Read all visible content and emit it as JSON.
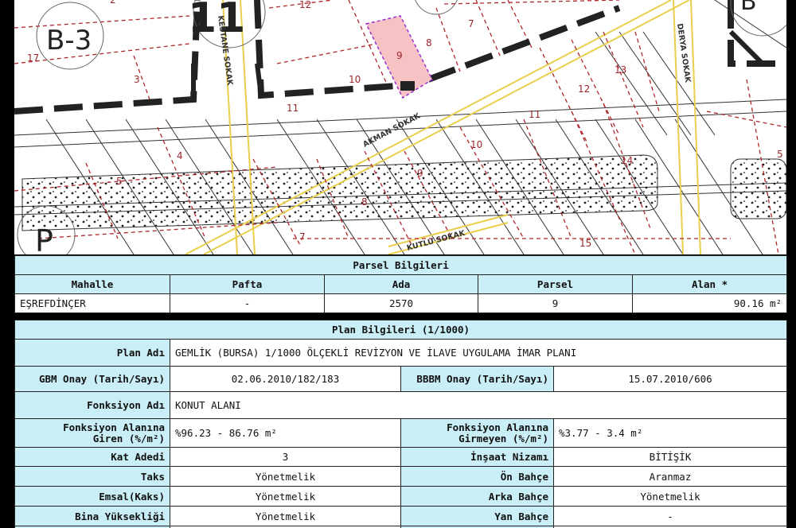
{
  "map": {
    "block_labels": [
      "B-3",
      "11",
      "P",
      "B"
    ],
    "streets": [
      "KESTANE SOKAK",
      "DERYA SOKAK",
      "AKMAN SOKAK",
      "KUTLU SOKAK"
    ],
    "parcel_numbers": [
      "2",
      "12",
      "17",
      "3",
      "7",
      "8",
      "9",
      "10",
      "11",
      "13",
      "12",
      "11",
      "10",
      "9",
      "8",
      "4",
      "5",
      "7",
      "14",
      "15",
      "5"
    ],
    "highlight_color": "#f6c2c4",
    "highlight_border": "#9b2fcf"
  },
  "parsel": {
    "title": "Parsel Bilgileri",
    "headers": [
      "Mahalle",
      "Pafta",
      "Ada",
      "Parsel",
      "Alan *"
    ],
    "values": [
      "EŞREFDİNÇER",
      "-",
      "2570",
      "9",
      "90.16 m²"
    ]
  },
  "plan": {
    "title": "Plan Bilgileri (1/1000)",
    "plan_adi_label": "Plan Adı",
    "plan_adi_value": "GEMLİK (BURSA) 1/1000 ÖLÇEKLİ REVİZYON VE İLAVE UYGULAMA İMAR PLANI",
    "gbm_label": "GBM Onay (Tarih/Sayı)",
    "gbm_value": "02.06.2010/182/183",
    "bbbm_label": "BBBM Onay (Tarih/Sayı)",
    "bbbm_value": "15.07.2010/606",
    "fonksiyon_label": "Fonksiyon Adı",
    "fonksiyon_value": "KONUT ALANI",
    "giren_label_1": "Fonksiyon Alanına",
    "giren_label_2": "Giren (%/m²)",
    "giren_value": "%96.23 - 86.76 m²",
    "girmeyen_label_1": "Fonksiyon Alanına",
    "girmeyen_label_2": "Girmeyen (%/m²)",
    "girmeyen_value": "%3.77 - 3.4 m²",
    "kat_label": "Kat Adedi",
    "kat_value": "3",
    "insaat_label": "İnşaat Nizamı",
    "insaat_value": "BİTİŞİK",
    "taks_label": "Taks",
    "taks_value": "Yönetmelik",
    "on_label": "Ön Bahçe",
    "on_value": "Aranmaz",
    "emsal_label": "Emsal(Kaks)",
    "emsal_value": "Yönetmelik",
    "arka_label": "Arka Bahçe",
    "arka_value": "Yönetmelik",
    "bina_label": "Bina Yüksekliği",
    "bina_value": "Yönetmelik",
    "yan_label": "Yan Bahçe",
    "yan_value": "-"
  }
}
